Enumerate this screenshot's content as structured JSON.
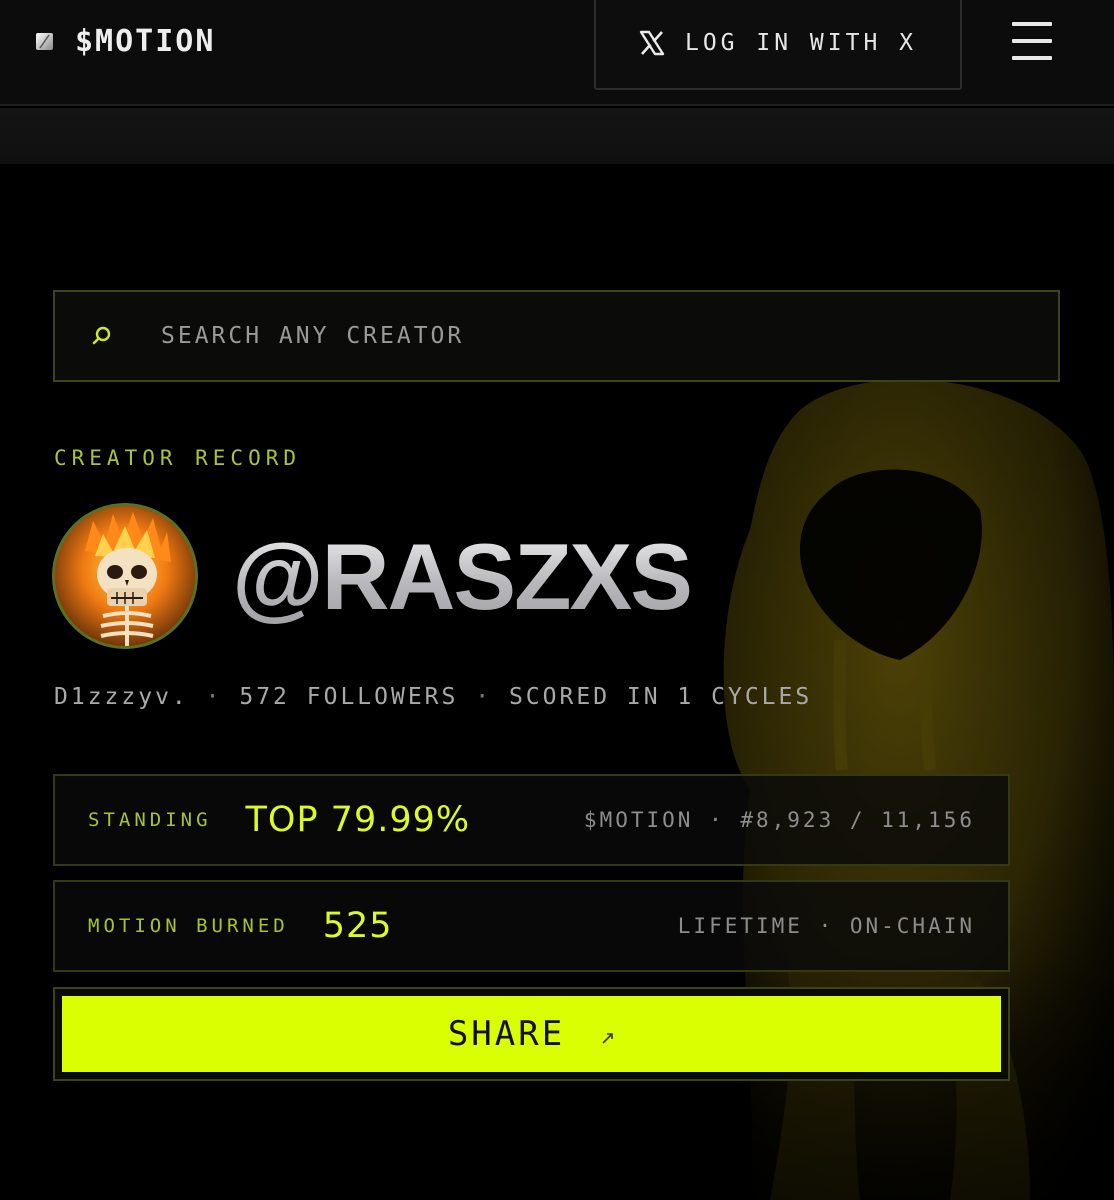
{
  "header": {
    "brand": "$MOTION",
    "login_label": "LOG IN WITH X"
  },
  "search": {
    "placeholder": "SEARCH ANY CREATOR"
  },
  "profile": {
    "section_label": "CREATOR RECORD",
    "handle": "@RASZXS",
    "display_name": "D1zzzyv.",
    "separator": "·",
    "followers": "572 FOLLOWERS",
    "cycles": "SCORED IN 1 CYCLES"
  },
  "standing": {
    "label": "STANDING",
    "value": "TOP 79.99%",
    "detail": "$MOTION · #8,923 / 11,156"
  },
  "burned": {
    "label": "MOTION BURNED",
    "value": "525",
    "detail": "LIFETIME · ON-CHAIN"
  },
  "share": {
    "label": "SHARE"
  },
  "colors": {
    "accent": "#d9ff00",
    "accent_text": "#dcfb24",
    "label_green": "#a7c43a",
    "panel_border": "#333a12",
    "background": "#000000"
  },
  "icons": {
    "brand": "brand-logo-icon",
    "login": "x-logo-icon",
    "menu": "hamburger-menu-icon",
    "search": "search-icon",
    "share": "arrow-up-right-icon"
  }
}
